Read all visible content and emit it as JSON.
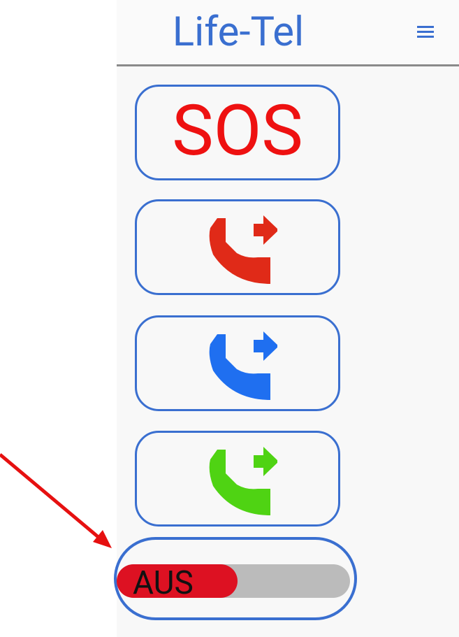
{
  "header": {
    "title": "Life-Tel",
    "menu_icon": "hamburger-menu-icon"
  },
  "buttons": {
    "sos_label": "SOS",
    "red_call": {
      "icon": "phone-forward-icon",
      "color": "#e02a18"
    },
    "blue_call": {
      "icon": "phone-forward-icon",
      "color": "#1f6ff0"
    },
    "green_call": {
      "icon": "phone-forward-icon",
      "color": "#4fd313"
    }
  },
  "toggle": {
    "label": "AUS",
    "state": "off",
    "fill_color": "#dd1122",
    "track_color": "#bbbbbb"
  },
  "annotation": {
    "arrow_color": "#e61010"
  },
  "colors": {
    "accent": "#3a6fd0",
    "sos": "#ee1111"
  }
}
